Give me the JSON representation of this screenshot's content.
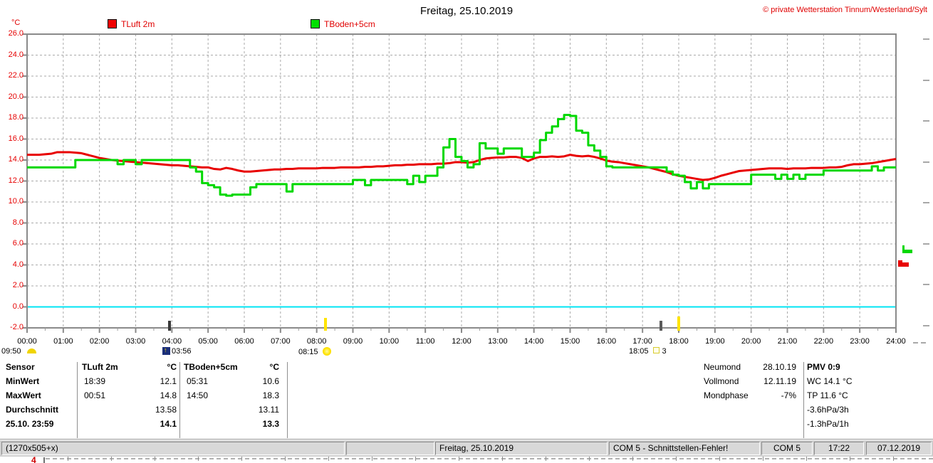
{
  "header": {
    "title": "Freitag, 25.10.2019",
    "copyright": "© private Wetterstation Tinnum/Westerland/Sylt",
    "unit": "°C",
    "legend": [
      {
        "label": "TLuft 2m",
        "color": "#f00000"
      },
      {
        "label": "TBoden+5cm",
        "color": "#00e000"
      }
    ]
  },
  "chart_data": {
    "type": "line",
    "title": "Freitag, 25.10.2019",
    "ylabel": "°C",
    "ylim": [
      -2.0,
      26.0
    ],
    "grid": true,
    "zero_line_color": "#00e4f4",
    "y_ticks": [
      "26.0",
      "24.0",
      "22.0",
      "20.0",
      "18.0",
      "16.0",
      "14.0",
      "12.0",
      "10.0",
      "8.0",
      "6.0",
      "4.0",
      "2.0",
      "0.0",
      "-2.0"
    ],
    "x_ticks": [
      "00:00",
      "01:00",
      "02:00",
      "03:00",
      "04:00",
      "05:00",
      "06:00",
      "07:00",
      "08:00",
      "09:00",
      "10:00",
      "11:00",
      "12:00",
      "13:00",
      "14:00",
      "15:00",
      "16:00",
      "17:00",
      "18:00",
      "19:00",
      "20:00",
      "21:00",
      "22:00",
      "23:00",
      "24:00"
    ],
    "x_start_hour": 0,
    "x_end_hour": 24,
    "step_minutes": 10,
    "series": [
      {
        "name": "TLuft 2m",
        "color": "#e80000",
        "style": "linear",
        "values": [
          14.5,
          14.5,
          14.5,
          14.55,
          14.6,
          14.75,
          14.75,
          14.75,
          14.7,
          14.65,
          14.5,
          14.35,
          14.2,
          14.1,
          14.0,
          13.95,
          13.9,
          13.85,
          13.8,
          13.75,
          13.7,
          13.65,
          13.6,
          13.55,
          13.5,
          13.5,
          13.45,
          13.4,
          13.35,
          13.3,
          13.3,
          13.15,
          13.1,
          13.25,
          13.15,
          13.0,
          12.9,
          12.9,
          12.95,
          13.0,
          13.05,
          13.1,
          13.1,
          13.15,
          13.15,
          13.2,
          13.2,
          13.2,
          13.2,
          13.25,
          13.25,
          13.25,
          13.3,
          13.3,
          13.3,
          13.3,
          13.35,
          13.35,
          13.4,
          13.4,
          13.45,
          13.5,
          13.5,
          13.55,
          13.55,
          13.6,
          13.6,
          13.6,
          13.65,
          13.65,
          13.7,
          13.8,
          13.8,
          13.75,
          13.8,
          14.0,
          14.15,
          14.2,
          14.25,
          14.25,
          14.3,
          14.3,
          14.2,
          13.9,
          14.15,
          14.3,
          14.3,
          14.35,
          14.3,
          14.35,
          14.5,
          14.4,
          14.35,
          14.4,
          14.3,
          14.15,
          13.95,
          13.85,
          13.8,
          13.7,
          13.6,
          13.5,
          13.4,
          13.3,
          13.15,
          13.0,
          12.85,
          12.65,
          12.5,
          12.4,
          12.3,
          12.2,
          12.1,
          12.15,
          12.3,
          12.5,
          12.65,
          12.8,
          12.95,
          13.0,
          13.05,
          13.1,
          13.15,
          13.2,
          13.2,
          13.2,
          13.15,
          13.2,
          13.2,
          13.2,
          13.25,
          13.25,
          13.25,
          13.3,
          13.3,
          13.35,
          13.5,
          13.6,
          13.6,
          13.65,
          13.7,
          13.8,
          13.9,
          14.0,
          14.1
        ]
      },
      {
        "name": "TBoden+5cm",
        "color": "#00d800",
        "style": "step",
        "values": [
          13.3,
          13.3,
          13.3,
          13.3,
          13.3,
          13.3,
          13.3,
          13.3,
          14.0,
          14.0,
          14.0,
          14.0,
          14.0,
          14.0,
          14.0,
          13.6,
          14.0,
          14.0,
          13.6,
          14.0,
          14.0,
          14.0,
          14.0,
          14.0,
          14.0,
          14.0,
          14.0,
          13.3,
          12.9,
          11.8,
          11.6,
          11.4,
          10.7,
          10.6,
          10.7,
          10.7,
          10.7,
          11.4,
          11.7,
          11.7,
          11.7,
          11.7,
          11.7,
          11.0,
          11.7,
          11.7,
          11.7,
          11.7,
          11.7,
          11.7,
          11.7,
          11.7,
          11.7,
          11.7,
          12.1,
          12.1,
          11.6,
          12.1,
          12.1,
          12.1,
          12.1,
          12.1,
          12.1,
          11.7,
          12.5,
          11.9,
          12.5,
          12.5,
          13.3,
          15.2,
          16.0,
          14.3,
          13.9,
          13.3,
          13.6,
          15.6,
          15.1,
          15.1,
          14.6,
          15.1,
          15.1,
          15.1,
          14.3,
          14.3,
          14.7,
          15.9,
          16.6,
          17.2,
          17.9,
          18.3,
          18.2,
          16.8,
          16.6,
          15.4,
          14.9,
          14.3,
          13.4,
          13.3,
          13.3,
          13.3,
          13.3,
          13.3,
          13.3,
          13.3,
          13.3,
          13.3,
          12.9,
          12.6,
          12.5,
          11.9,
          11.3,
          11.9,
          11.3,
          11.7,
          11.7,
          11.7,
          11.7,
          11.7,
          11.7,
          11.7,
          12.6,
          12.6,
          12.6,
          12.6,
          12.2,
          12.6,
          12.2,
          12.6,
          12.2,
          12.6,
          12.6,
          12.6,
          13.0,
          13.0,
          13.0,
          13.0,
          13.0,
          13.0,
          13.0,
          13.0,
          13.4,
          13.0,
          13.3,
          13.3,
          13.3
        ]
      }
    ]
  },
  "events": [
    {
      "time": "09:50",
      "icon": "moonset-icon"
    },
    {
      "time": "03:56",
      "icon": "moonrise-icon"
    },
    {
      "time": "08:15",
      "icon": "sunrise-icon"
    },
    {
      "time": "18:05",
      "icon": "sunset-icon",
      "extra": "3"
    }
  ],
  "table": {
    "row_labels": [
      "Sensor",
      "MinWert",
      "MaxWert",
      "Durchschnitt",
      "25.10. 23:59"
    ],
    "columns": [
      {
        "header": "TLuft 2m",
        "unit": "°C",
        "min_time": "18:39",
        "min_value": "12.1",
        "max_time": "00:51",
        "max_value": "14.8",
        "avg": "13.58",
        "last": "14.1"
      },
      {
        "header": "TBoden+5cm",
        "unit": "°C",
        "min_time": "05:31",
        "min_value": "10.6",
        "max_time": "14:50",
        "max_value": "18.3",
        "avg": "13.11",
        "last": "13.3"
      }
    ]
  },
  "astro": {
    "rows": [
      [
        "Neumond",
        "28.10.19"
      ],
      [
        "Vollmond",
        "12.11.19"
      ],
      [
        "Mondphase",
        "-7%"
      ]
    ]
  },
  "env": {
    "lines": [
      "PMV 0:9",
      "WC 14.1 °C",
      "TP 11.6 °C",
      "-3.6hPa/3h",
      "-1.3hPa/1h"
    ]
  },
  "statusbar": {
    "cells": [
      "(1270x505+x)",
      "",
      "Freitag, 25.10.2019",
      "COM 5 - Schnittstellen-Fehler!",
      "COM 5",
      "17:22",
      "07.12.2019"
    ]
  },
  "background_window": {
    "fragment": "4"
  }
}
